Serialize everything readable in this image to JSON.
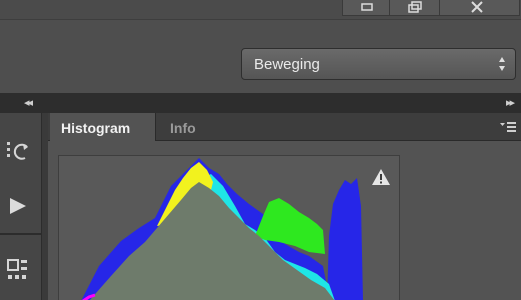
{
  "window": {
    "buttons": [
      {
        "name": "minimize",
        "icon": "minimize-icon"
      },
      {
        "name": "restore",
        "icon": "restore-icon"
      },
      {
        "name": "close",
        "icon": "close-icon"
      }
    ]
  },
  "options_bar": {
    "mode_select": {
      "value": "Beweging",
      "icon": "updown-arrows-icon"
    }
  },
  "panel_header": {
    "collapse_left_icon": "double-chevron-left-icon",
    "expand_right_icon": "double-chevron-right-icon"
  },
  "toolbar": {
    "tools": [
      {
        "name": "history-brush",
        "icon": "history-brush-icon"
      },
      {
        "name": "play",
        "icon": "play-icon"
      },
      {
        "name": "tool-grid",
        "icon": "grid-tool-icon"
      }
    ]
  },
  "panel": {
    "tabs": [
      {
        "label": "Histogram",
        "active": true
      },
      {
        "label": "Info",
        "active": false
      }
    ],
    "menu_icon": "panel-menu-icon",
    "histogram": {
      "warning_icon": "cache-warning-icon",
      "channel_colors": {
        "red": "#ff00ff",
        "yellow": "#f2f21e",
        "green": "#2ee81f",
        "cyan": "#1fe6e6",
        "blue": "#2626e8",
        "luminosity": "#6e7b6b"
      }
    }
  }
}
